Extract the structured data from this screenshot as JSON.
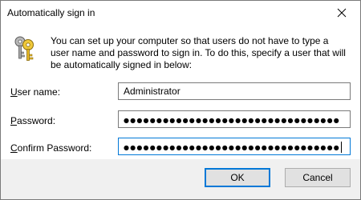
{
  "window": {
    "title": "Automatically sign in"
  },
  "description": "You can set up your computer so that users do not have to type a user name and password to sign in. To do this, specify a user that will be automatically signed in below:",
  "fields": {
    "username": {
      "label_accel": "U",
      "label_rest": "ser name:",
      "value": "Administrator"
    },
    "password": {
      "label_accel": "P",
      "label_rest": "assword:",
      "value": "●●●●●●●●●●●●●●●●●●●●●●●●●●●●●●●●●"
    },
    "confirm": {
      "label_accel": "C",
      "label_rest": "onfirm Password:",
      "value": "●●●●●●●●●●●●●●●●●●●●●●●●●●●●●●●●●"
    }
  },
  "buttons": {
    "ok": "OK",
    "cancel": "Cancel"
  },
  "icons": {
    "dialog": "keys-icon",
    "close": "close-icon"
  }
}
